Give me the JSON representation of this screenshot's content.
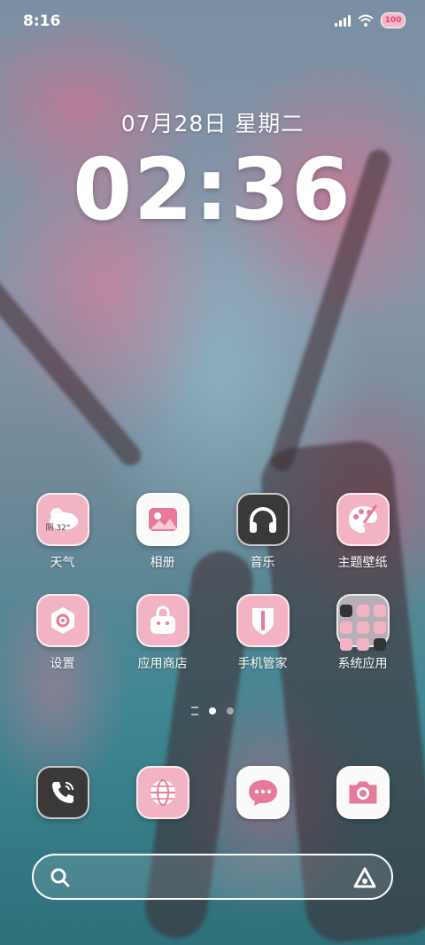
{
  "status_bar": {
    "time": "8:16",
    "battery": "100",
    "icons": [
      "signal-icon",
      "wifi-icon",
      "battery-icon"
    ]
  },
  "lockclock": {
    "date": "07月28日  星期二",
    "time": "02:36"
  },
  "apps": {
    "row1": [
      {
        "label": "天气",
        "icon": "weather-icon",
        "badge": "阴 32°"
      },
      {
        "label": "相册",
        "icon": "gallery-icon"
      },
      {
        "label": "音乐",
        "icon": "headphones-icon"
      },
      {
        "label": "主题壁纸",
        "icon": "palette-icon"
      }
    ],
    "row2": [
      {
        "label": "设置",
        "icon": "gear-icon"
      },
      {
        "label": "应用商店",
        "icon": "shopping-bag-icon"
      },
      {
        "label": "手机管家",
        "icon": "shield-icon"
      },
      {
        "label": "系统应用",
        "icon": "folder-icon"
      }
    ]
  },
  "dock": [
    {
      "icon": "phone-icon"
    },
    {
      "icon": "browser-icon"
    },
    {
      "icon": "messages-icon"
    },
    {
      "icon": "camera-icon"
    }
  ],
  "page_indicator": {
    "pages": 2,
    "current": 1
  },
  "search": {
    "placeholder": ""
  },
  "colors": {
    "accent_pink": "#f2b3c4",
    "icon_pink_dark": "#e0728f",
    "dark_icon": "#3a3838"
  }
}
